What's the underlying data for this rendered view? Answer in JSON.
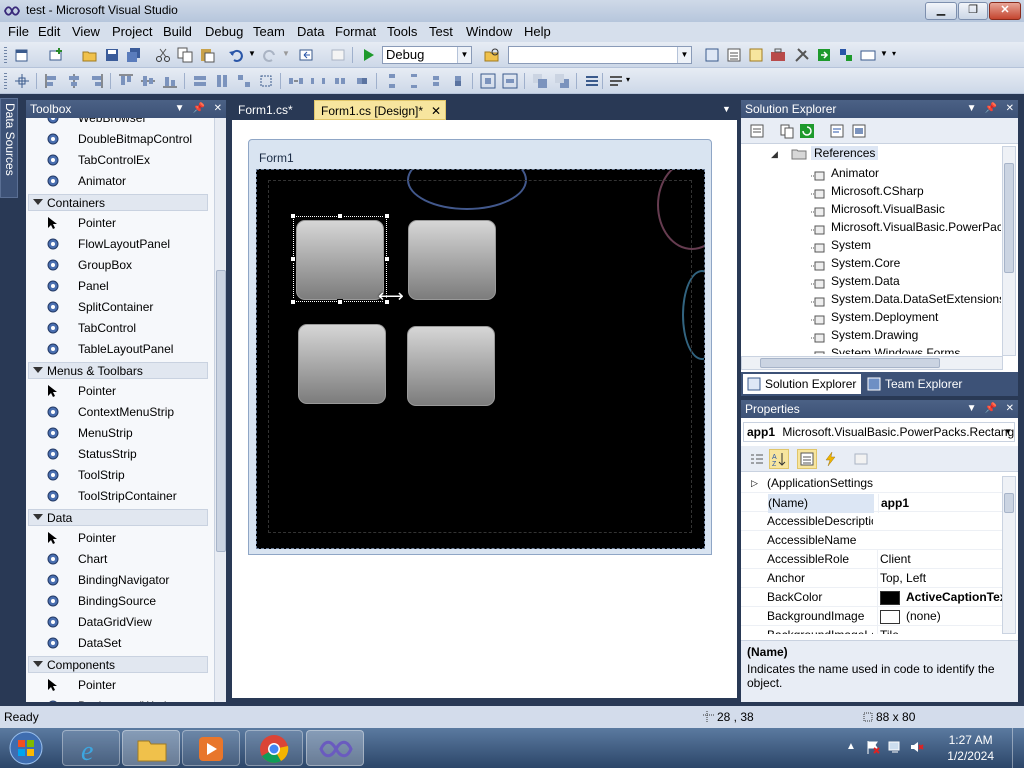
{
  "window": {
    "title": "test - Microsoft Visual Studio"
  },
  "menu": [
    "File",
    "Edit",
    "View",
    "Project",
    "Build",
    "Debug",
    "Team",
    "Data",
    "Format",
    "Tools",
    "Test",
    "Window",
    "Help"
  ],
  "toolbar": {
    "config": "Debug",
    "platform": ""
  },
  "data_sources_tab": "Data Sources",
  "toolbox": {
    "title": "Toolbox",
    "items_top": [
      "WebBrowser",
      "DoubleBitmapControl",
      "TabControlEx",
      "Animator"
    ],
    "groups": [
      {
        "name": "Containers",
        "items": [
          "Pointer",
          "FlowLayoutPanel",
          "GroupBox",
          "Panel",
          "SplitContainer",
          "TabControl",
          "TableLayoutPanel"
        ]
      },
      {
        "name": "Menus & Toolbars",
        "items": [
          "Pointer",
          "ContextMenuStrip",
          "MenuStrip",
          "StatusStrip",
          "ToolStrip",
          "ToolStripContainer"
        ]
      },
      {
        "name": "Data",
        "items": [
          "Pointer",
          "Chart",
          "BindingNavigator",
          "BindingSource",
          "DataGridView",
          "DataSet"
        ]
      },
      {
        "name": "Components",
        "items": [
          "Pointer",
          "BackgroundWorker"
        ]
      }
    ]
  },
  "doc_tabs": [
    {
      "label": "Form1.cs*",
      "active": false
    },
    {
      "label": "Form1.cs [Design]*",
      "active": true
    }
  ],
  "form": {
    "title": "Form1"
  },
  "solution_explorer": {
    "title": "Solution Explorer",
    "references_label": "References",
    "references": [
      "Animator",
      "Microsoft.CSharp",
      "Microsoft.VisualBasic",
      "Microsoft.VisualBasic.PowerPacks",
      "System",
      "System.Core",
      "System.Data",
      "System.Data.DataSetExtensions",
      "System.Deployment",
      "System.Drawing",
      "System.Windows.Forms"
    ],
    "tab_solution": "Solution Explorer",
    "tab_team": "Team Explorer"
  },
  "properties": {
    "title": "Properties",
    "object": "app1",
    "object_type": "Microsoft.VisualBasic.PowerPacks.Rectang",
    "rows": [
      {
        "name": "(ApplicationSettings",
        "value": ""
      },
      {
        "name": "(Name)",
        "value": "app1"
      },
      {
        "name": "AccessibleDescriptic",
        "value": ""
      },
      {
        "name": "AccessibleName",
        "value": ""
      },
      {
        "name": "AccessibleRole",
        "value": "Client"
      },
      {
        "name": "Anchor",
        "value": "Top, Left"
      },
      {
        "name": "BackColor",
        "value": "ActiveCaptionTex"
      },
      {
        "name": "BackgroundImage",
        "value": "(none)"
      },
      {
        "name": "BackgroundImageLayout",
        "value": "Tile"
      }
    ],
    "desc_title": "(Name)",
    "desc_text": "Indicates the name used in code to identify the object."
  },
  "status": {
    "text": "Ready",
    "position": "28 , 38",
    "size": "88 x 80"
  },
  "clock": {
    "time": "1:27 AM",
    "date": "1/2/2024"
  },
  "colors": {
    "accent": "#293955",
    "tab_active": "#f7e59e",
    "panel_header": "#3d5277"
  },
  "icons": [
    "windows-start-icon",
    "internet-explorer-icon",
    "file-explorer-icon",
    "media-player-icon",
    "chrome-icon",
    "visual-studio-icon"
  ]
}
